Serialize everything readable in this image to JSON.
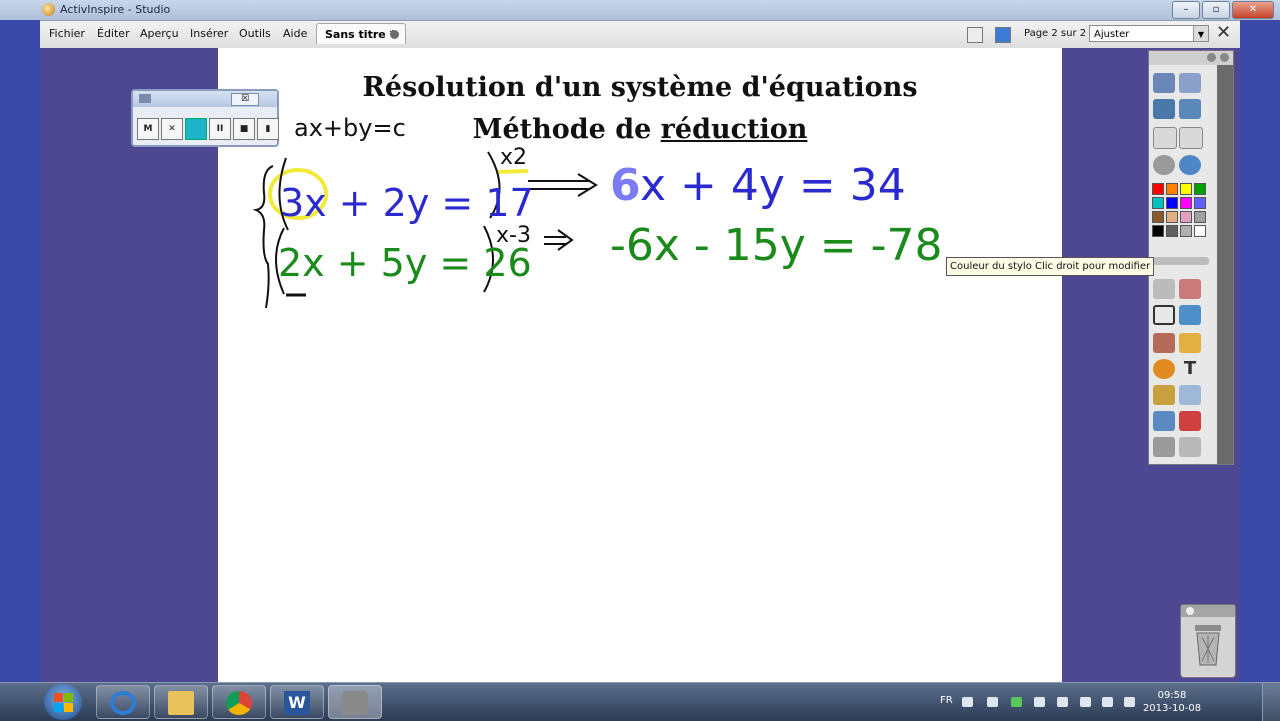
{
  "window": {
    "title": "ActivInspire - Studio"
  },
  "menu": [
    "Fichier",
    "Éditer",
    "Aperçu",
    "Insérer",
    "Outils",
    "Aide"
  ],
  "document_tab": "Sans titre *",
  "pager": {
    "text": "Page 2 sur 2"
  },
  "zoom": {
    "value": "Ajuster"
  },
  "page": {
    "heading1": "Résolution d'un système d'équations",
    "heading2_prefix": "Méthode de ",
    "heading2_underlined": "réduction"
  },
  "handwriting": {
    "form": "ax+by=c",
    "eq1": "3x + 2y = 17",
    "mult1": "x2",
    "eq2": "2x + 5y = 26",
    "mult2": "x-3",
    "res1_lead": "6",
    "res1": "x + 4y = 34",
    "res2": "-6x - 15y = -78"
  },
  "recorder": {
    "buttons": [
      "M",
      "✕",
      "",
      "II",
      "■",
      "▮"
    ],
    "close": "☒"
  },
  "tooltip": "Couleur du stylo Clic droit pour modifier",
  "palette": [
    "#ff0000",
    "#ff8000",
    "#ffff00",
    "#00a000",
    "#00c0c0",
    "#0000ff",
    "#ff00ff",
    "#6060ff",
    "#8b5a2b",
    "#e0b080",
    "#e0a0c0",
    "#a0a0a0",
    "#000000",
    "#606060",
    "#b0b0b0",
    "#ffffff"
  ],
  "taskbar": {
    "lang": "FR",
    "time": "09:58",
    "date": "2013-10-08"
  }
}
